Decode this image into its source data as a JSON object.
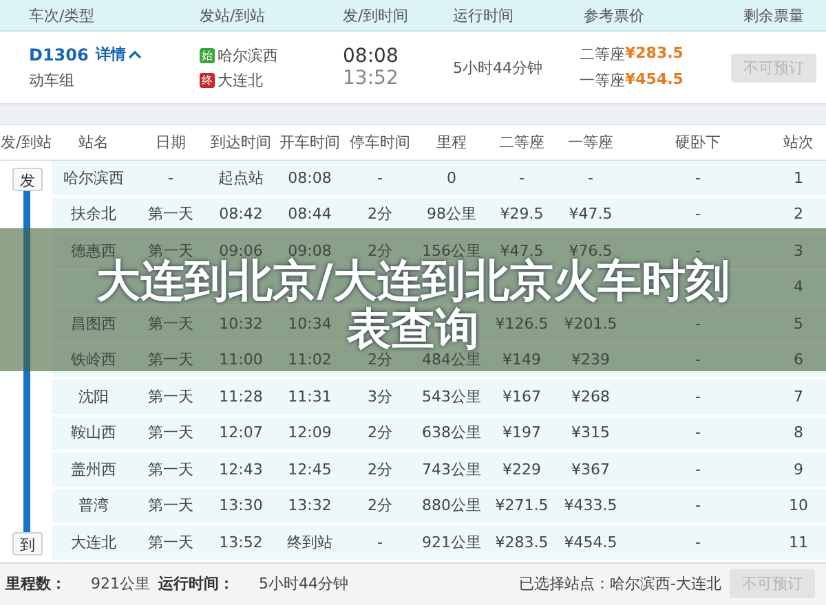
{
  "header_columns": [
    "车次/类型",
    "发站/到站",
    "发/到时间",
    "运行时间",
    "参考票价",
    "剩余票量"
  ],
  "train": {
    "number": "D1306",
    "details_link": "详情",
    "expanded": true,
    "type": "动车组",
    "from": {
      "tag": "始",
      "name": "哈尔滨西"
    },
    "to": {
      "tag": "终",
      "name": "大连北"
    },
    "depart": "08:08",
    "arrive": "13:52",
    "duration": "5小时44分钟",
    "prices": [
      {
        "class": "二等座",
        "price": "¥283.5"
      },
      {
        "class": "一等座",
        "price": "¥454.5"
      }
    ],
    "book_button": {
      "label": "不可预订",
      "disabled": true
    }
  },
  "stops_table": {
    "route_header": "发/到站",
    "columns": [
      "站名",
      "日期",
      "到达时间",
      "开车时间",
      "停车时间",
      "里程",
      "二等座",
      "一等座",
      "硬卧下",
      "站次"
    ],
    "route": {
      "start_tag": "发",
      "end_tag": "到"
    },
    "rows": [
      {
        "cells": [
          "哈尔滨西",
          "-",
          "起点站",
          "08:08",
          "-",
          "0",
          "-",
          "-",
          "-",
          "1"
        ]
      },
      {
        "cells": [
          "扶余北",
          "第一天",
          "08:42",
          "08:44",
          "2分",
          "98公里",
          "¥29.5",
          "¥47.5",
          "-",
          "2"
        ]
      },
      {
        "cells": [
          "德惠西",
          "第一天",
          "09:06",
          "09:08",
          "2分",
          "156公里",
          "¥47.5",
          "¥76.5",
          "-",
          "3"
        ]
      },
      {
        "cells": [
          null,
          null,
          null,
          null,
          null,
          null,
          null,
          null,
          null,
          "4"
        ]
      },
      {
        "cells": [
          "昌图西",
          "第一天",
          "10:32",
          "10:34",
          null,
          null,
          "¥126.5",
          "¥201.5",
          "-",
          "5"
        ]
      },
      {
        "cells": [
          "铁岭西",
          "第一天",
          "11:00",
          "11:02",
          "2分",
          "484公里",
          "¥149",
          "¥239",
          "-",
          "6"
        ]
      },
      {
        "cells": [
          "沈阳",
          "第一天",
          "11:28",
          "11:31",
          "3分",
          "543公里",
          "¥167",
          "¥268",
          "-",
          "7"
        ]
      },
      {
        "cells": [
          "鞍山西",
          "第一天",
          "12:07",
          "12:09",
          "2分",
          "638公里",
          "¥197",
          "¥315",
          "-",
          "8"
        ]
      },
      {
        "cells": [
          "盖州西",
          "第一天",
          "12:43",
          "12:45",
          "2分",
          "743公里",
          "¥229",
          "¥367",
          "-",
          "9"
        ]
      },
      {
        "cells": [
          "普湾",
          "第一天",
          "13:30",
          "13:32",
          "2分",
          "880公里",
          "¥271.5",
          "¥433.5",
          "-",
          "10"
        ]
      },
      {
        "cells": [
          "大连北",
          "第一天",
          "13:52",
          "终到站",
          "-",
          "921公里",
          "¥283.5",
          "¥454.5",
          "-",
          "11"
        ]
      }
    ]
  },
  "summary": {
    "distance_label": "里程数：",
    "distance": "921公里",
    "duration_label": "运行时间：",
    "duration": "5小时44分钟",
    "selected_stations": "已选择站点：哈尔滨西-大连北",
    "book_button": {
      "label": "不可预订",
      "disabled": true
    }
  },
  "overlay_banner": {
    "title_lines": [
      "大连到北京/大连到北京火车时刻",
      "表查询"
    ]
  }
}
